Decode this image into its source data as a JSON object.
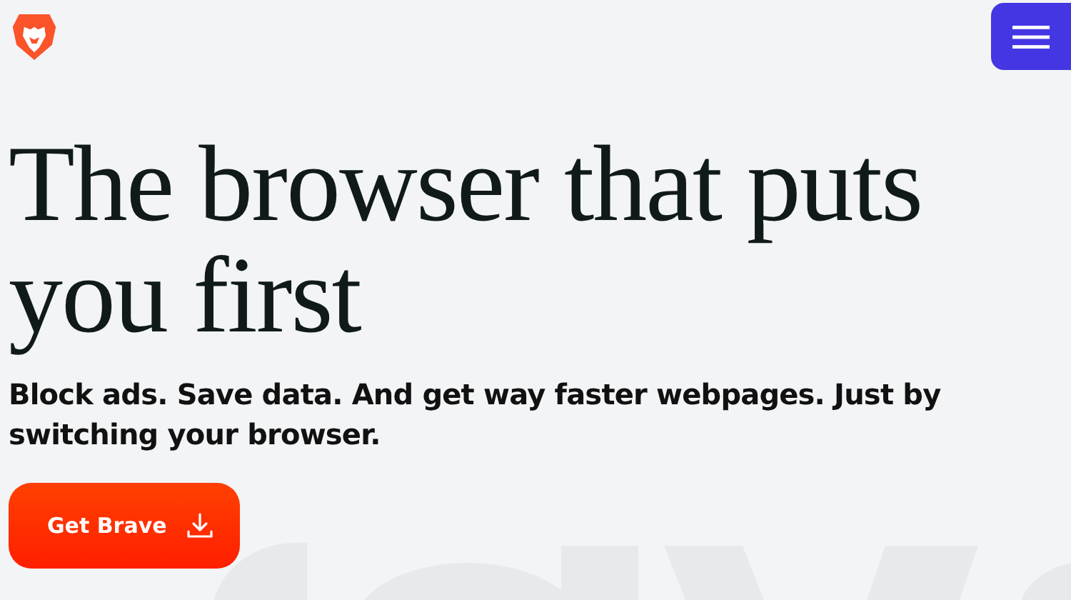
{
  "hero": {
    "headline": "The browser that puts you first",
    "subtitle": "Block ads. Save data. And get way faster webpages. Just by switching your browser.",
    "cta": {
      "label": "Get Brave"
    }
  }
}
